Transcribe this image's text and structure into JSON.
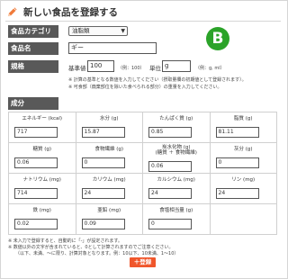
{
  "header": {
    "title": "新しい食品を登録する",
    "icon": "pencil-icon",
    "accent": "#f07a3a"
  },
  "form": {
    "category": {
      "label": "食品カテゴリ",
      "value": "油脂類"
    },
    "name": {
      "label": "食品名",
      "value": "ギー"
    },
    "spec": {
      "label": "規格",
      "base_label": "基準値",
      "base_value": "100",
      "base_hint": "（例：100）",
      "unit_label": "単位",
      "unit_value": "g",
      "unit_hint": "（例：g, ml）",
      "note1": "※ 計算の基準となる数値を入力してください（摂取量欄の初期値として登録されます）。",
      "note2": "※ 可食部（廃棄部位を除いた食べられる部分）の重量を入力してください。"
    }
  },
  "badge": {
    "text": "B",
    "color": "#2ba329"
  },
  "nutrients_label": "成分",
  "nutrients": [
    {
      "name": "エネルギー (kcal)",
      "value": "717"
    },
    {
      "name": "水分 (g)",
      "value": "15.87"
    },
    {
      "name": "たんぱく質 (g)",
      "value": "0.85"
    },
    {
      "name": "脂質 (g)",
      "value": "81.11"
    },
    {
      "name": "糖質 (g)",
      "value": "0.06"
    },
    {
      "name": "食物繊維 (g)",
      "value": "0"
    },
    {
      "name": "炭水化物 (g)",
      "name2": "(糖質 ＋ 食物繊維)",
      "value": "0.06"
    },
    {
      "name": "灰分 (g)",
      "value": "0"
    },
    {
      "name": "ナトリウム (mg)",
      "value": "714"
    },
    {
      "name": "カリウム (mg)",
      "value": "24"
    },
    {
      "name": "カルシウム (mg)",
      "value": "24"
    },
    {
      "name": "リン (mg)",
      "value": "24"
    },
    {
      "name": "鉄 (mg)",
      "value": "0.02"
    },
    {
      "name": "亜鉛 (mg)",
      "value": "0.09"
    },
    {
      "name": "食塩相当量 (g)",
      "value": "0"
    },
    {
      "name": "",
      "value": ""
    }
  ],
  "footer_notes": {
    "n1": "※ 未入力で登録すると、自動的に「-」が設定されます。",
    "n2": "※ 数値以外の文字が含まれていると、0として計算されますのでご注意ください。",
    "n3": "（以下、未満、〜に限り、計算対象となります。例：10以下、10未満、1〜10）"
  },
  "register_label": "＋登録"
}
